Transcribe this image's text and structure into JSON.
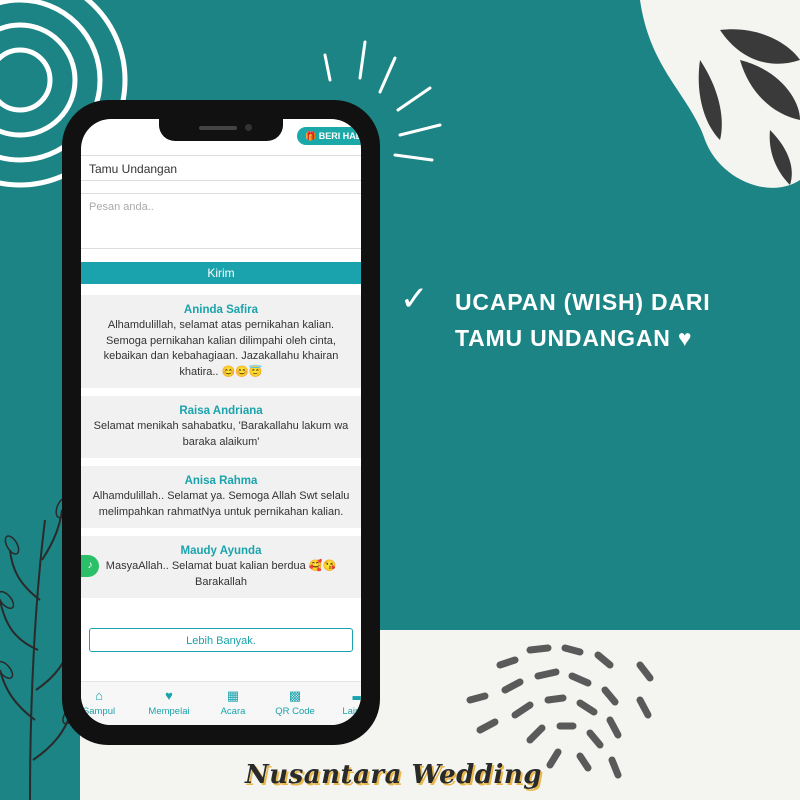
{
  "caption": {
    "check_icon": "checkmark-icon",
    "lines": [
      "UCAPAN (WISH) DARI",
      "TAMU UNDANGAN ♥"
    ]
  },
  "brand": "Nusantara Wedding",
  "phone": {
    "gift_button": "🎁 BERI HADIAH",
    "name_input": "Tamu Undangan",
    "message_placeholder": "Pesan anda..",
    "send_label": "Kirim",
    "wishes": [
      {
        "name": "Aninda Safira",
        "text": "Alhamdulillah, selamat atas pernikahan kalian. Semoga pernikahan kalian dilimpahi oleh cinta, kebaikan dan kebahagiaan. Jazakallahu khairan khatira.. 😊😊😇"
      },
      {
        "name": "Raisa Andriana",
        "text": "Selamat menikah sahabatku, 'Barakallahu lakum wa baraka alaikum'"
      },
      {
        "name": "Anisa Rahma",
        "text": "Alhamdulillah.. Selamat ya. Semoga Allah Swt selalu melimpahkan rahmatNya untuk pernikahan kalian."
      },
      {
        "name": "Maudy Ayunda",
        "text": "MasyaAllah.. Selamat buat kalian berdua 🥰😘 Barakallah"
      }
    ],
    "more_label": "Lebih Banyak.",
    "nav": [
      {
        "label": "Sampul",
        "icon": "home-icon"
      },
      {
        "label": "Mempelai",
        "icon": "heart-icon"
      },
      {
        "label": "Acara",
        "icon": "calendar-icon"
      },
      {
        "label": "QR Code",
        "icon": "qr-code-icon"
      },
      {
        "label": "Lainnya",
        "icon": "message-icon"
      }
    ]
  },
  "colors": {
    "background": "#1c8484",
    "accent": "#1aa3ac",
    "paper": "#f4f4f0"
  }
}
